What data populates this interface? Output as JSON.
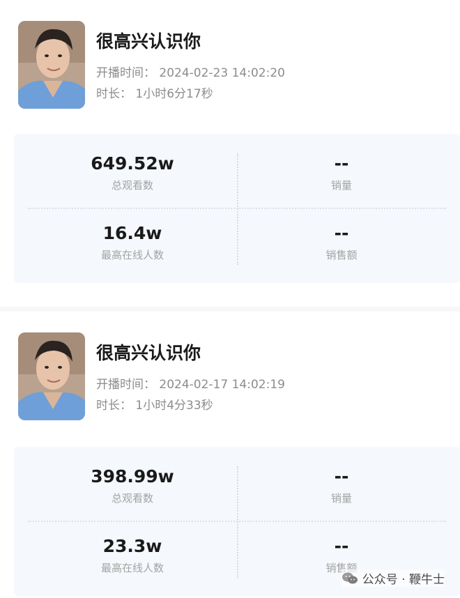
{
  "sessions": [
    {
      "title": "很高兴认识你",
      "start_time": "开播时间： 2024-02-23 14:02:20",
      "duration": "时长： 1小时6分17秒",
      "stats": {
        "total_views": {
          "value": "649.52w",
          "label": "总观看数"
        },
        "sales": {
          "value": "--",
          "label": "销量"
        },
        "peak_online": {
          "value": "16.4w",
          "label": "最高在线人数"
        },
        "sales_amount": {
          "value": "--",
          "label": "销售额"
        }
      }
    },
    {
      "title": "很高兴认识你",
      "start_time": "开播时间： 2024-02-17 14:02:19",
      "duration": "时长： 1小时4分33秒",
      "stats": {
        "total_views": {
          "value": "398.99w",
          "label": "总观看数"
        },
        "sales": {
          "value": "--",
          "label": "销量"
        },
        "peak_online": {
          "value": "23.3w",
          "label": "最高在线人数"
        },
        "sales_amount": {
          "value": "--",
          "label": "销售额"
        }
      }
    }
  ],
  "watermark": {
    "text": "公众号 · 鞭牛士",
    "icon": "wechat-icon"
  },
  "colors": {
    "card_bg": "#f5f8fc",
    "muted_text": "#8c8c8c",
    "label_text": "#a3a3a3",
    "value_text": "#1a1a1a"
  }
}
